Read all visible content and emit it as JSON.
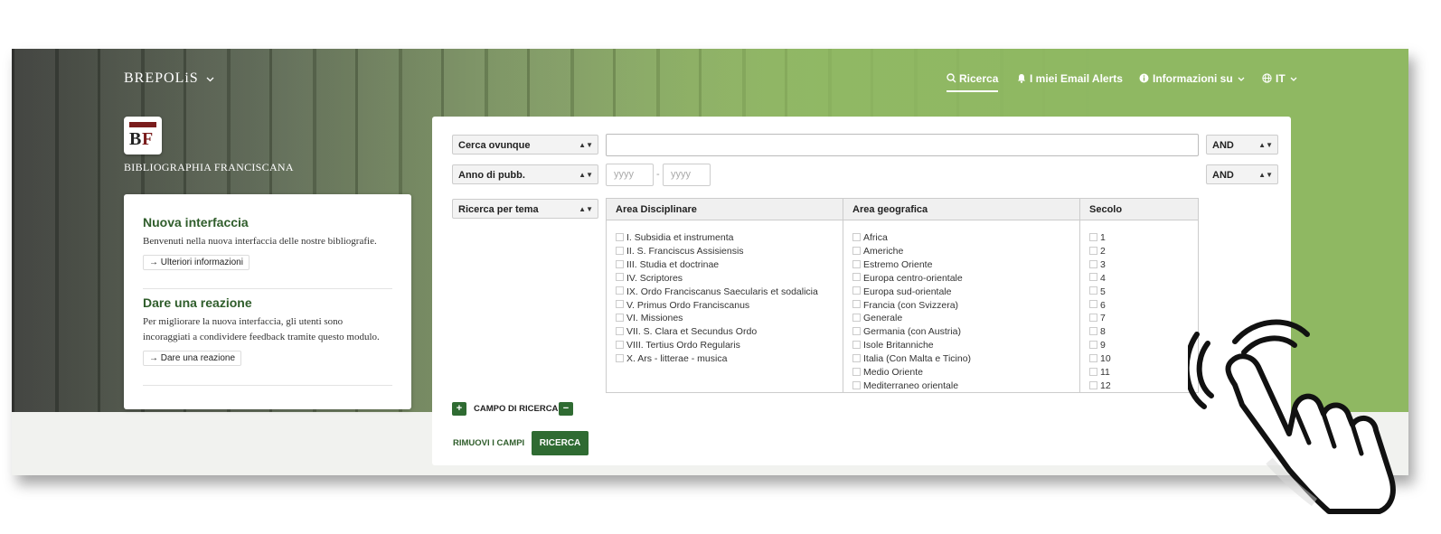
{
  "nav": {
    "brand": "BREPOLiS",
    "search": "Ricerca",
    "alerts": "I miei Email Alerts",
    "info": "Informazioni su",
    "lang": "IT"
  },
  "site": {
    "logo_b": "B",
    "logo_f": "F",
    "subtitle": "BIBLIOGRAPHIA FRANCISCANA"
  },
  "info_card": {
    "block1_title": "Nuova interfaccia",
    "block1_text": "Benvenuti nella nuova interfaccia delle nostre bibliografie.",
    "block1_button": "→ Ulteriori informazioni",
    "block2_title": "Dare una reazione",
    "block2_text": "Per migliorare la nuova interfaccia, gli utenti sono incoraggiati a condividere feedback tramite questo modulo.",
    "block2_button": "→ Dare una reazione"
  },
  "search": {
    "field1": "Cerca ovunque",
    "op1": "AND",
    "field2": "Anno di pubb.",
    "year_from": "yyyy",
    "year_to": "yyyy",
    "op2": "AND",
    "field3": "Ricerca per tema",
    "col1_header": "Area Disciplinare",
    "col2_header": "Area geografica",
    "col3_header": "Secolo",
    "col1_items": [
      "I. Subsidia et instrumenta",
      "II. S. Franciscus Assisiensis",
      "III. Studia et doctrinae",
      "IV. Scriptores",
      "IX. Ordo Franciscanus Saecularis et sodalicia",
      "V. Primus Ordo Franciscanus",
      "VI. Missiones",
      "VII. S. Clara et Secundus Ordo",
      "VIII. Tertius Ordo Regularis",
      "X. Ars - litterae - musica"
    ],
    "col2_items": [
      "Africa",
      "Americhe",
      "Estremo Oriente",
      "Europa centro-orientale",
      "Europa sud-orientale",
      "Francia (con Svizzera)",
      "Generale",
      "Germania (con Austria)",
      "Isole Britanniche",
      "Italia (Con Malta e Ticino)",
      "Medio Oriente",
      "Mediterraneo orientale"
    ],
    "col3_items": [
      "1",
      "2",
      "3",
      "4",
      "5",
      "6",
      "7",
      "8",
      "9",
      "10",
      "11",
      "12"
    ],
    "add_symbol": "+",
    "campo_label": "CAMPO DI RICERCA",
    "remove_symbol": "−",
    "rimuovi_label": "RIMUOVI I CAMPI",
    "ricerca_label": "RICERCA"
  },
  "icons": {
    "search": "search-icon",
    "bell": "bell-icon",
    "info": "info-icon",
    "globe": "globe-icon",
    "chevron": "chevron-down-icon",
    "hand": "tap-hand-icon"
  },
  "colors": {
    "accent_green": "#2f6b32",
    "heading_green": "#2f5d2b",
    "hero_green": "#8fb862",
    "logo_red": "#7a1c1c"
  }
}
